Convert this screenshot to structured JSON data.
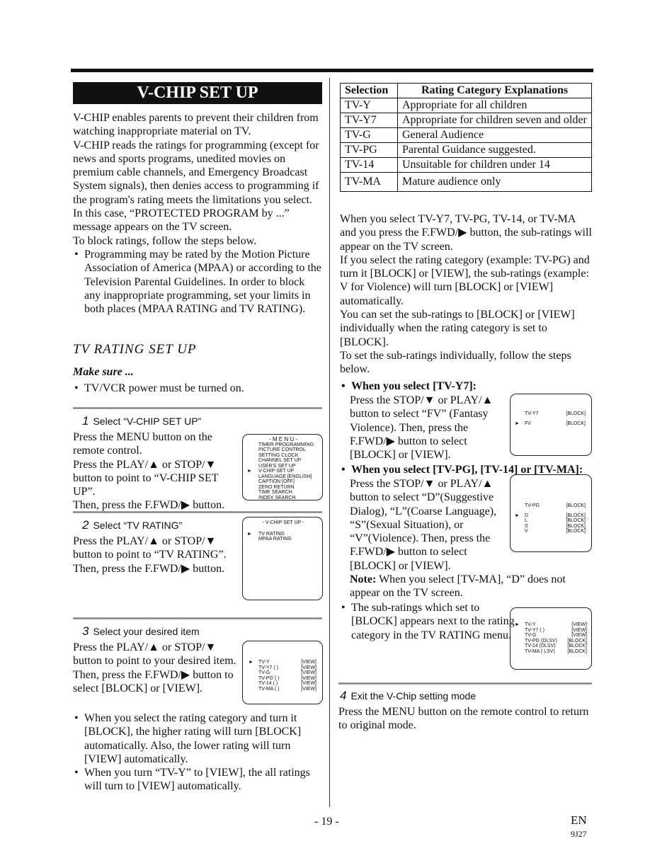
{
  "title": "V-CHIP SET UP",
  "intro": [
    "V-CHIP enables parents to prevent their children from watching inappropriate material on TV.",
    "V-CHIP reads the ratings for programming (except for news and sports programs, unedited movies on premium cable channels, and Emergency Broadcast System signals), then denies access to programming if the program's rating meets the limitations you select. In this case, “PROTECTED PROGRAM by ...” message appears on the TV screen.",
    "To block ratings, follow the steps below."
  ],
  "intro_bullet": "Programming may be rated by the Motion Picture Association of America (MPAA) or according to the Television Parental Guidelines. In order to block any inappropriate programming, set your limits in both places (MPAA RATING and TV RATING).",
  "section_title": "TV RATING SET UP",
  "make_sure": "Make sure ...",
  "make_sure_bullet": "TV/VCR power must be turned on.",
  "steps": [
    {
      "num": "1",
      "title": "Select “V-CHIP SET UP”",
      "lines": [
        "Press the MENU button on the remote control.",
        "Press the PLAY/▲ or STOP/▼ button to point to “V-CHIP SET UP”.",
        "Then, press the F.FWD/▶ button."
      ]
    },
    {
      "num": "2",
      "title": "Select “TV RATING”",
      "lines": [
        "Press the PLAY/▲ or STOP/▼ button to point to “TV RATING”.",
        "Then, press the F.FWD/▶ button."
      ]
    },
    {
      "num": "3",
      "title": "Select your desired item",
      "lines": [
        "Press the PLAY/▲ or STOP/▼ button to point to your desired item.",
        "Then, press the F.FWD/▶ button to select [BLOCK] or [VIEW]."
      ]
    },
    {
      "num": "4",
      "title": "Exit the V-Chip setting mode",
      "lines": [
        "Press the MENU button on the remote control to return to original mode."
      ]
    }
  ],
  "menu_screen": {
    "title": "- M E N U -",
    "items": [
      "TIMER PROGRAMMING",
      "PICTURE CONTROL",
      "SETTING CLOCK",
      "CHANNEL SET UP",
      "USER'S SET UP",
      "V-CHIP SET UP",
      "LANGUAGE  [ENGLISH]",
      "CAPTION  [OFF]",
      "ZERO RETURN",
      "TIME SEARCH",
      "INDEX SEARCH"
    ]
  },
  "vchip_screen": {
    "title": "- V-CHIP SET UP -",
    "items": [
      "TV RATING",
      "MPAA RATING"
    ]
  },
  "rating_screen": {
    "rows": [
      [
        "TV-Y",
        "[VIEW]"
      ],
      [
        "TV-Y7 (        )",
        "[VIEW]"
      ],
      [
        "TV-G",
        "[VIEW]"
      ],
      [
        "TV-PG (        )",
        "[VIEW]"
      ],
      [
        "TV-14 (        )",
        "[VIEW]"
      ],
      [
        "TV-MA (        )",
        "[VIEW]"
      ]
    ]
  },
  "left_bullets": [
    "When you select the rating category and turn it [BLOCK], the higher rating will turn [BLOCK] automatically. Also, the lower rating will turn [VIEW] automatically.",
    "When you turn “TV-Y” to [VIEW], the all ratings will turn to [VIEW] automatically."
  ],
  "table": {
    "headers": [
      "Selection",
      "Rating Category Explanations"
    ],
    "rows": [
      [
        "TV-Y",
        "Appropriate for all children"
      ],
      [
        "TV-Y7",
        "Appropriate for children seven and older"
      ],
      [
        "TV-G",
        "General Audience"
      ],
      [
        "TV-PG",
        "Parental Guidance suggested."
      ],
      [
        "TV-14",
        "Unsuitable for children under 14"
      ],
      [
        "TV-MA",
        "Mature audience only"
      ]
    ]
  },
  "right_paras": [
    "When you select TV-Y7, TV-PG, TV-14, or TV-MA and you press the F.FWD/▶ button, the sub-ratings will appear on the TV screen.",
    "If you select the rating category (example: TV-PG) and turn it [BLOCK] or [VIEW], the sub-ratings (example: V for Violence) will turn [BLOCK] or [VIEW] automatically.",
    "You can set the sub-ratings to [BLOCK] or [VIEW] individually when the rating category is set to [BLOCK].",
    "To set the sub-ratings individually, follow the steps below."
  ],
  "sub1": {
    "head": "When you select [TV-Y7]:",
    "text": "Press the STOP/▼ or PLAY/▲ button to select “FV” (Fantasy Violence). Then, press the F.FWD/▶ button to select [BLOCK] or [VIEW]."
  },
  "screen_y7": {
    "rows": [
      [
        "TV-Y7",
        "[BLOCK]"
      ],
      [
        "FV",
        "[BLOCK]"
      ]
    ]
  },
  "sub2": {
    "head": "When you select [TV-PG], [TV-14] or [TV-MA]:",
    "text": "Press the STOP/▼ or PLAY/▲ button to select “D”(Suggestive Dialog), “L”(Coarse Language), “S”(Sexual Situation), or “V”(Violence). Then, press the F.FWD/▶ button to select [BLOCK] or [VIEW].",
    "note_label": "Note:",
    "note": " When you select [TV-MA], “D” does not appear on the TV screen."
  },
  "screen_pg": {
    "rows": [
      [
        "TV-PG",
        "[BLOCK]"
      ],
      [
        "D",
        "[BLOCK]"
      ],
      [
        "L",
        "[BLOCK]"
      ],
      [
        "S",
        "[BLOCK]"
      ],
      [
        "V",
        "[BLOCK]"
      ]
    ]
  },
  "sub3": "The sub-ratings which set to [BLOCK] appears next to the rating category in the TV RATING menu.",
  "screen_final": {
    "rows": [
      [
        "TV-Y",
        "[VIEW]"
      ],
      [
        "TV-Y7 (        )",
        "[VIEW]"
      ],
      [
        "TV-G",
        "[VIEW]"
      ],
      [
        "TV-PG (DLSV)",
        "[BLOCK]"
      ],
      [
        "TV-14 (DLSV)",
        "[BLOCK]"
      ],
      [
        "TV-MA ( LSV)",
        "[BLOCK]"
      ]
    ]
  },
  "footer": {
    "page": "- 19 -",
    "lang": "EN",
    "code": "9J27"
  }
}
